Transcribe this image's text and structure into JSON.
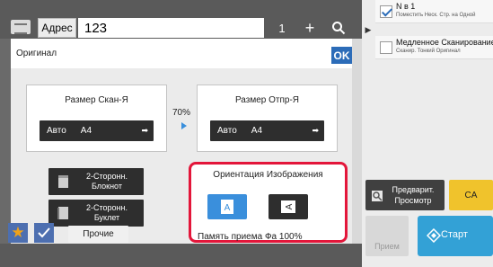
{
  "topbar": {
    "address_label": "Адрес",
    "address_value": "123",
    "count": "1",
    "plus": "+"
  },
  "dialog": {
    "title": "Оригинал",
    "ok_label": "OK",
    "scan_size": {
      "title": "Размер Скан-Я",
      "mode": "Авто",
      "size": "A4"
    },
    "ratio": "70%",
    "send_size": {
      "title": "Размер Отпр-Я",
      "mode": "Авто",
      "size": "A4"
    },
    "duplex_book": "2-Сторонн.\nБлокнот",
    "duplex_booklet": "2-Сторонн.\nБуклет",
    "orientation": {
      "title": "Ориентация Изображения",
      "portrait_icon": "portrait-letter-A-icon",
      "landscape_icon": "landscape-letter-A-icon"
    }
  },
  "bottombar": {
    "other_label": "Прочие",
    "memory_text": "Память приема Фа 100%"
  },
  "rightpanel": {
    "items": [
      {
        "main": "N в 1",
        "sub": "Поместить Неск. Стр. на Одной",
        "checked": true
      },
      {
        "main": "Медленное Сканирование",
        "sub": "Сканир. Тонкий Оригинал",
        "checked": false
      }
    ],
    "preview_label": "Предварит.\nПросмотр",
    "ca_label": "CA",
    "priem_label": "Прием",
    "start_label": "Старт"
  },
  "colors": {
    "accent_blue": "#2c6cb8",
    "start_blue": "#33a1d6",
    "ca_yellow": "#f0c32c",
    "highlight_red": "#e3163a"
  }
}
